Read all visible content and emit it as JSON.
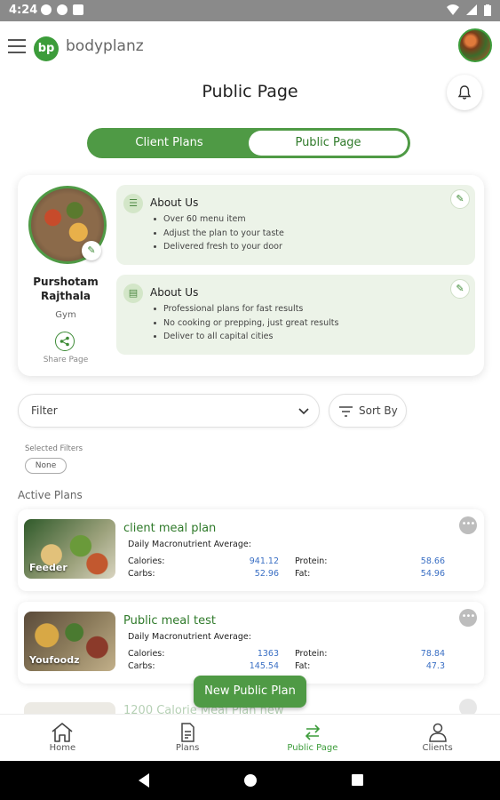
{
  "status_bar": {
    "time": "4:24"
  },
  "app": {
    "brand": "bodyplanz",
    "logo_text": "bp"
  },
  "page": {
    "title": "Public Page"
  },
  "toggle": {
    "left_label": "Client Plans",
    "right_label": "Public Page",
    "selected": "Public Page"
  },
  "profile": {
    "name": "Purshotam Rajthala",
    "role": "Gym",
    "share_label": "Share Page",
    "about_sections": [
      {
        "title": "About Us",
        "items": [
          "Over 60 menu item",
          "Adjust the plan to your taste",
          "Delivered fresh to your door"
        ]
      },
      {
        "title": "About Us",
        "items": [
          "Professional plans for fast results",
          "No cooking or prepping, just great results",
          "Deliver to all capital cities"
        ]
      }
    ]
  },
  "filters": {
    "filter_label": "Filter",
    "sort_label": "Sort By",
    "selected_label": "Selected Filters",
    "selected_value": "None"
  },
  "active_plans": {
    "label": "Active Plans",
    "plans": [
      {
        "brand": "Feeder",
        "title": "client meal plan",
        "subtitle": "Daily Macronutrient Average:",
        "calories_label": "Calories:",
        "calories": "941.12",
        "carbs_label": "Carbs:",
        "carbs": "52.96",
        "protein_label": "Protein:",
        "protein": "58.66",
        "fat_label": "Fat:",
        "fat": "54.96"
      },
      {
        "brand": "Youfoodz",
        "title": "Public meal test",
        "subtitle": "Daily Macronutrient Average:",
        "calories_label": "Calories:",
        "calories": "1363",
        "carbs_label": "Carbs:",
        "carbs": "145.54",
        "protein_label": "Protein:",
        "protein": "78.84",
        "fat_label": "Fat:",
        "fat": "47.3"
      },
      {
        "title": "1200 Calorie Meal Plan new"
      }
    ]
  },
  "new_plan_button": "New Public Plan",
  "bottom_nav": [
    {
      "label": "Home",
      "icon": "home-icon"
    },
    {
      "label": "Plans",
      "icon": "document-icon"
    },
    {
      "label": "Public Page",
      "icon": "swap-arrows-icon",
      "active": true
    },
    {
      "label": "Clients",
      "icon": "person-icon"
    }
  ],
  "colors": {
    "accent": "#4f9a45",
    "value_blue": "#3a6fc4",
    "about_bg": "#ecf3e8"
  }
}
